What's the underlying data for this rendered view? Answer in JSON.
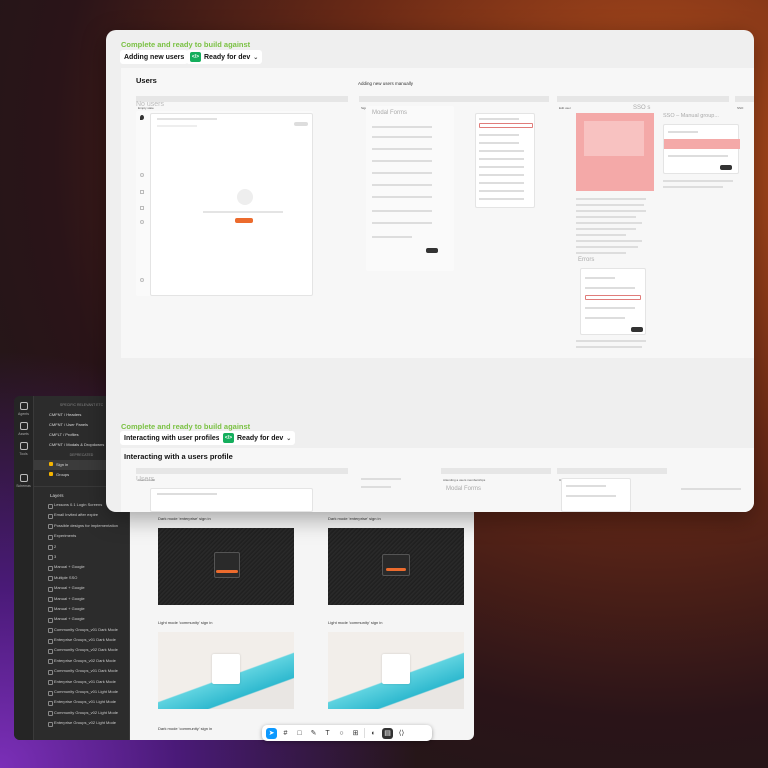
{
  "back_window": {
    "rail": [
      {
        "label": "Agents"
      },
      {
        "label": "Assets"
      },
      {
        "label": "Tools"
      },
      {
        "label": "Schemas"
      }
    ],
    "pages": [
      {
        "label": "SPECIFIC RELEVANT ETC",
        "type": "sep"
      },
      {
        "label": "CMFNT / Headers"
      },
      {
        "label": "CMFNT / User Panels"
      },
      {
        "label": "CMFLT / Profiles"
      },
      {
        "label": "CMFNT / Modals & Dropdowns"
      },
      {
        "label": "DEPRECATED",
        "type": "sep"
      },
      {
        "label": "Sign in",
        "color": "#f5b400",
        "selected": true
      },
      {
        "label": "Groups",
        "color": "#f5b400"
      }
    ],
    "layers_heading": "Layers",
    "layers": [
      "Lessons 0.1 Login Screens",
      "Email Invited after expire",
      "Possible designs for implementation",
      "Experiments",
      "2",
      "3",
      "Manual + Google",
      "Multiple SSO",
      "Manual + Google",
      "Manual + Google",
      "Manual + Google",
      "Manual + Google",
      "Community Groups_v01 Dark Mode",
      "Enterprise Groups_v01 Dark Mode",
      "Community Groups_v02 Dark Mode",
      "Enterprise Groups_v02 Dark Mode",
      "Community Groups_v01 Dark Mode",
      "Enterprise Groups_v01 Dark Mode",
      "Community Groups_v01 Light Mode",
      "Enterprise Groups_v01 Light Mode",
      "Community Groups_v02 Light Mode",
      "Enterprise Groups_v02 Light Mode"
    ],
    "screens": [
      {
        "label": "Dark mode 'enterprise' sign in"
      },
      {
        "label": "Dark mode 'enterprise' sign in"
      },
      {
        "label": "Light mode 'community' sign in"
      },
      {
        "label": "Light mode 'community' sign in"
      },
      {
        "label": "Dark mode 'community' sign in"
      }
    ]
  },
  "main_window": {
    "section1": {
      "status": "Complete and ready to build against",
      "frame_name": "Adding new users",
      "ready_label": "Ready for dev",
      "page_title": "Users",
      "subtitle": "Adding new users manually",
      "empty_heading": "No users",
      "modal_heading": "Modal Forms",
      "sso_heading": "SSO s",
      "sso_manual": "SSO – Manual group...",
      "errors_heading": "Errors",
      "col_labels": [
        "Empty state",
        "Sign user",
        "Edit user",
        "SSO"
      ]
    },
    "section2": {
      "status": "Complete and ready to build against",
      "frame_name": "Interacting with user profiles",
      "ready_label": "Ready for dev",
      "page_title": "Interacting with a users profile",
      "empty_heading": "Users",
      "modal_heading": "Modal Forms",
      "col_labels": [
        "Users modal",
        "Attending a users memberships",
        "User details modal"
      ]
    }
  },
  "toolbar": {
    "tools": [
      "move-tool",
      "frame-tool",
      "shape-tool",
      "pen-tool",
      "text-tool",
      "comment-tool",
      "actions-tool",
      "dev-mode",
      "layers",
      "settings",
      "code"
    ]
  },
  "colors": {
    "status_green": "#7ac143",
    "ready_green": "#14ae5c",
    "accent_orange": "#ec6b2d",
    "error_pink": "#f4a9a8"
  }
}
